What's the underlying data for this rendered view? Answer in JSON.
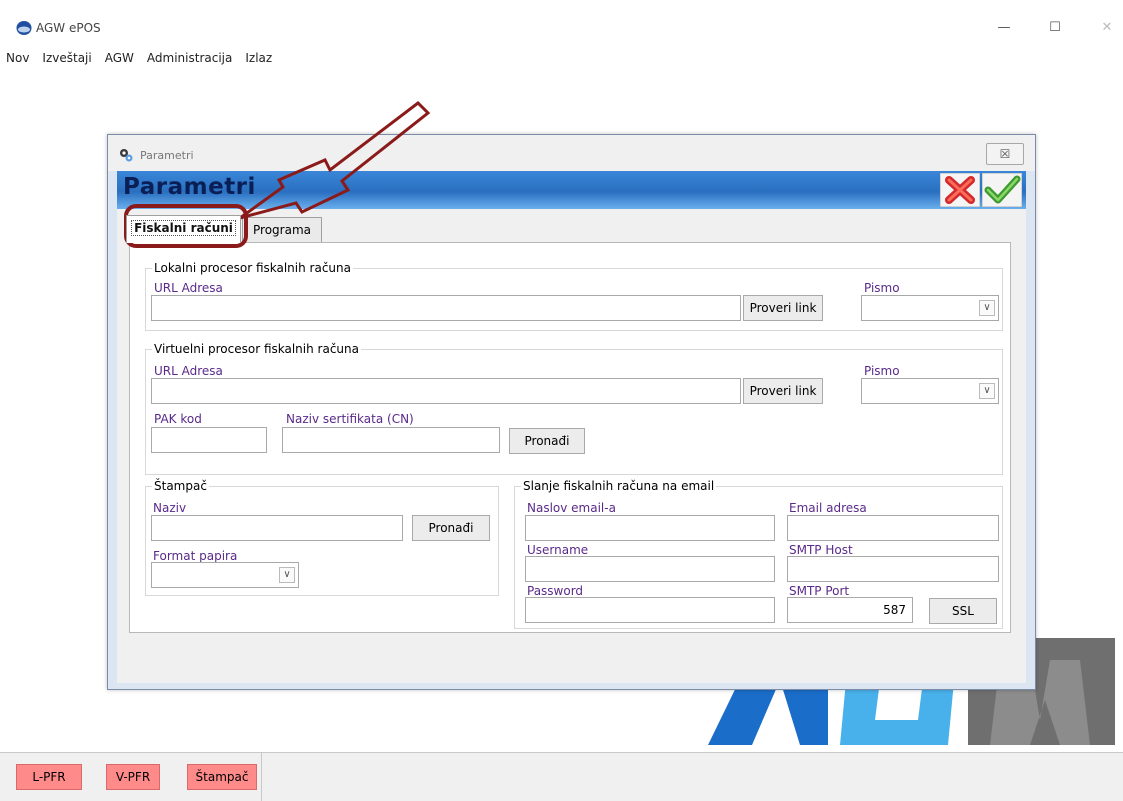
{
  "app": {
    "title": "AGW ePOS",
    "window_controls": {
      "minimize": "—",
      "maximize": "☐",
      "close": "✕"
    }
  },
  "menu": [
    {
      "label": "Nov"
    },
    {
      "label": "Izveštaji"
    },
    {
      "label": "AGW"
    },
    {
      "label": "Administracija"
    },
    {
      "label": "Izlaz"
    }
  ],
  "statusbar": {
    "buttons": [
      {
        "label": "L-PFR"
      },
      {
        "label": "V-PFR"
      },
      {
        "label": "Štampač"
      }
    ]
  },
  "dialog": {
    "window_title": "Parametri",
    "heading": "Parametri",
    "close_glyph": "☒",
    "tabs": [
      {
        "label": "Fiskalni računi",
        "active": true
      },
      {
        "label": "Programa",
        "active": false
      }
    ],
    "lokalni": {
      "title": "Lokalni procesor fiskalnih računa",
      "url_label": "URL Adresa",
      "url_value": "",
      "check_button": "Proveri link",
      "pismo_label": "Pismo",
      "pismo_value": ""
    },
    "virtuelni": {
      "title": "Virtuelni procesor fiskalnih računa",
      "url_label": "URL Adresa",
      "url_value": "",
      "check_button": "Proveri link",
      "pismo_label": "Pismo",
      "pismo_value": "",
      "pak_label": "PAK kod",
      "pak_value": "",
      "cert_label": "Naziv sertifikata (CN)",
      "cert_value": "",
      "find_button": "Pronađi"
    },
    "stampac": {
      "title": "Štampač",
      "naziv_label": "Naziv",
      "naziv_value": "",
      "find_button": "Pronađi",
      "format_label": "Format papira",
      "format_value": ""
    },
    "email": {
      "title": "Slanje fiskalnih računa na email",
      "subject_label": "Naslov email-a",
      "subject_value": "",
      "address_label": "Email adresa",
      "address_value": "",
      "username_label": "Username",
      "username_value": "",
      "host_label": "SMTP Host",
      "host_value": "",
      "password_label": "Password",
      "password_value": "",
      "port_label": "SMTP Port",
      "port_value": "587",
      "ssl_button": "SSL"
    }
  },
  "colors": {
    "header_blue": "#2a6fc0",
    "label_purple": "#5a2a8a",
    "status_button": "#ff8a8a",
    "annotation": "#8b1a1a"
  },
  "icons": {
    "app": "app-logo-icon",
    "cancel": "red-x-icon",
    "ok": "green-check-icon",
    "dropdown": "chevron-down-icon"
  }
}
